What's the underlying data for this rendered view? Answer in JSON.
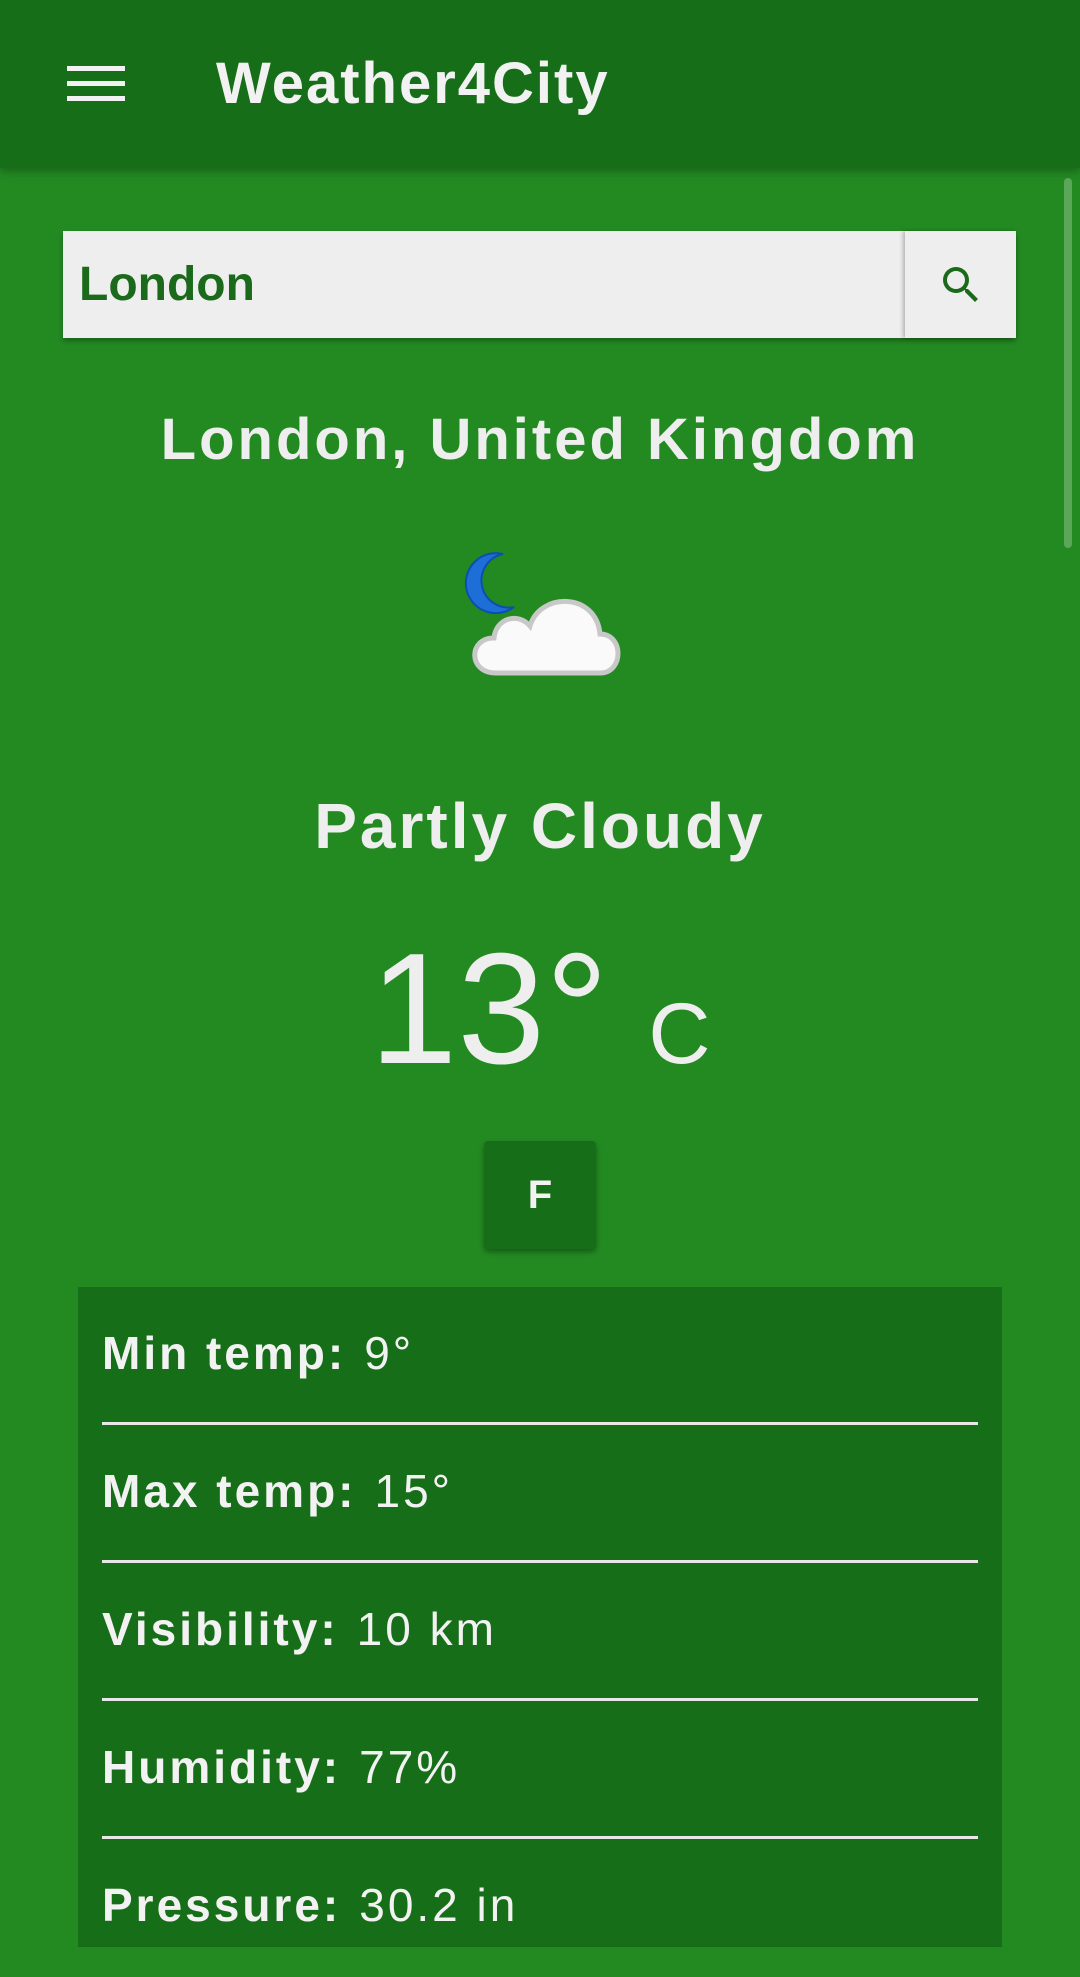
{
  "app": {
    "title": "Weather4City",
    "accent": "#176E18",
    "background": "#238A22"
  },
  "icons": {
    "menu": "hamburger-menu-icon",
    "search": "search-icon",
    "weather": "partly-cloudy-night-icon"
  },
  "search": {
    "value": "London",
    "placeholder": ""
  },
  "current": {
    "location": "London, United Kingdom",
    "condition": "Partly Cloudy",
    "temperature": "13°",
    "unit": "C",
    "toggle_label": "F"
  },
  "details": [
    {
      "label": "Min temp:",
      "value": "9°"
    },
    {
      "label": "Max temp:",
      "value": "15°"
    },
    {
      "label": "Visibility:",
      "value": "10 km"
    },
    {
      "label": "Humidity:",
      "value": "77%"
    },
    {
      "label": "Pressure:",
      "value": "30.2 in"
    }
  ]
}
